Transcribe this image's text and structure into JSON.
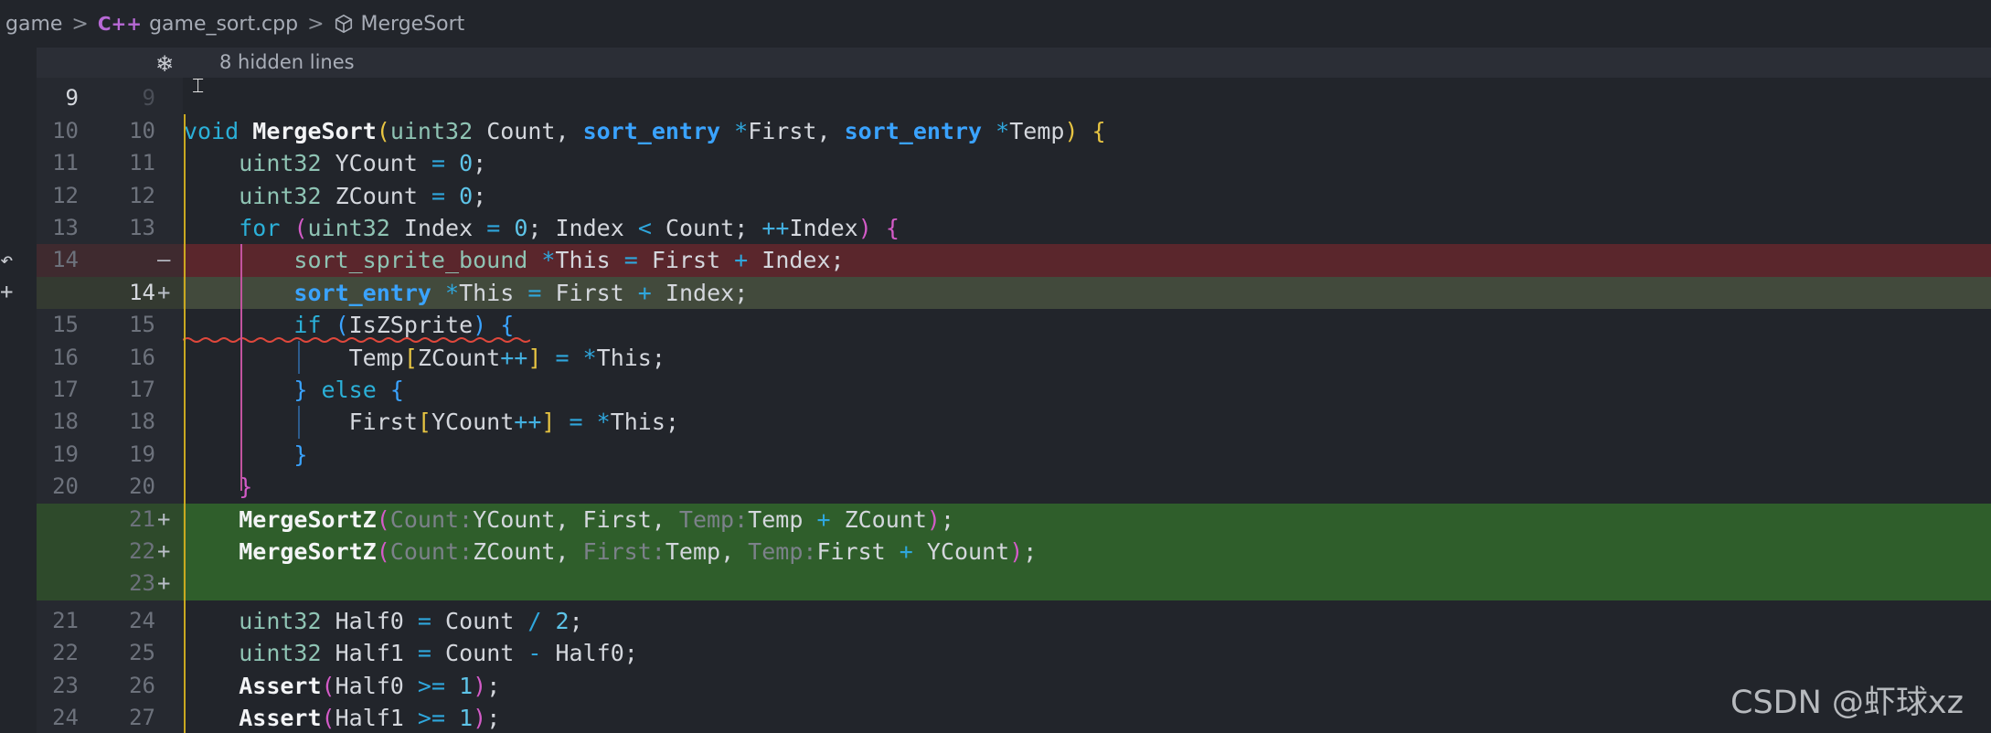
{
  "breadcrumb": {
    "items": [
      "game",
      "game_sort.cpp",
      "MergeSort"
    ],
    "separator": ">",
    "file_icon": "C++"
  },
  "fold": {
    "text": "8 hidden lines",
    "icon": "unfold-snowflake-icon"
  },
  "colors": {
    "deleted_line": "#5a262c",
    "modified_line": "#424a3c",
    "added_line": "#2f5e2b",
    "background": "#22252b"
  },
  "rows": [
    {
      "old": "9",
      "new": "9",
      "mark": ""
    },
    {
      "old": "10",
      "new": "10",
      "mark": ""
    },
    {
      "old": "11",
      "new": "11",
      "mark": ""
    },
    {
      "old": "12",
      "new": "12",
      "mark": ""
    },
    {
      "old": "13",
      "new": "13",
      "mark": ""
    },
    {
      "old": "14",
      "new": "",
      "mark": "—"
    },
    {
      "old": "",
      "new": "14",
      "mark": "+"
    },
    {
      "old": "15",
      "new": "15",
      "mark": ""
    },
    {
      "old": "16",
      "new": "16",
      "mark": ""
    },
    {
      "old": "17",
      "new": "17",
      "mark": ""
    },
    {
      "old": "18",
      "new": "18",
      "mark": ""
    },
    {
      "old": "19",
      "new": "19",
      "mark": ""
    },
    {
      "old": "20",
      "new": "20",
      "mark": ""
    },
    {
      "old": "",
      "new": "21",
      "mark": "+"
    },
    {
      "old": "",
      "new": "22",
      "mark": "+"
    },
    {
      "old": "",
      "new": "23",
      "mark": "+"
    },
    {
      "old": "21",
      "new": "24",
      "mark": ""
    },
    {
      "old": "22",
      "new": "25",
      "mark": ""
    },
    {
      "old": "23",
      "new": "26",
      "mark": ""
    },
    {
      "old": "24",
      "new": "27",
      "mark": ""
    }
  ],
  "code": {
    "l10": {
      "kw": "void",
      "fn": "MergeSort",
      "ty": "uint32",
      "p1": "Count",
      "t2": "sort_entry",
      "p2": "First",
      "t3": "sort_entry",
      "p3": "Temp"
    },
    "l11": {
      "ty": "uint32",
      "name": "YCount",
      "val": "0"
    },
    "l12": {
      "ty": "uint32",
      "name": "ZCount",
      "val": "0"
    },
    "l13": {
      "kw": "for",
      "ty": "uint32",
      "var": "Index",
      "init": "0",
      "limit": "Count",
      "inc": "++",
      "incvar": "Index"
    },
    "l14d": {
      "ty": "sort_sprite_bound",
      "name": "This",
      "a": "First",
      "b": "Index"
    },
    "l14a": {
      "ty": "sort_entry",
      "name": "This",
      "a": "First",
      "b": "Index"
    },
    "l15": {
      "kw": "if",
      "cond": "IsZSprite"
    },
    "l16": {
      "arr": "Temp",
      "idx": "ZCount",
      "inc": "++",
      "rhs": "This"
    },
    "l17": {
      "kw": "else"
    },
    "l18": {
      "arr": "First",
      "idx": "YCount",
      "inc": "++",
      "rhs": "This"
    },
    "l21": {
      "fn": "MergeSortZ",
      "h1": "Count:",
      "a1": "YCount",
      "a2": "First",
      "h3": "Temp:",
      "a3": "Temp",
      "a3b": "ZCount"
    },
    "l22": {
      "fn": "MergeSortZ",
      "h1": "Count:",
      "a1": "ZCount",
      "h2": "First:",
      "a2": "Temp",
      "h3": "Temp:",
      "a3": "First",
      "a3b": "YCount"
    },
    "l24": {
      "ty": "uint32",
      "name": "Half0",
      "a": "Count",
      "b": "2"
    },
    "l25": {
      "ty": "uint32",
      "name": "Half1",
      "a": "Count",
      "b": "Half0"
    },
    "l26": {
      "fn": "Assert",
      "a": "Half0",
      "b": "1"
    },
    "l27": {
      "fn": "Assert",
      "a": "Half1",
      "b": "1"
    }
  },
  "watermark": "CSDN @虾球xz"
}
